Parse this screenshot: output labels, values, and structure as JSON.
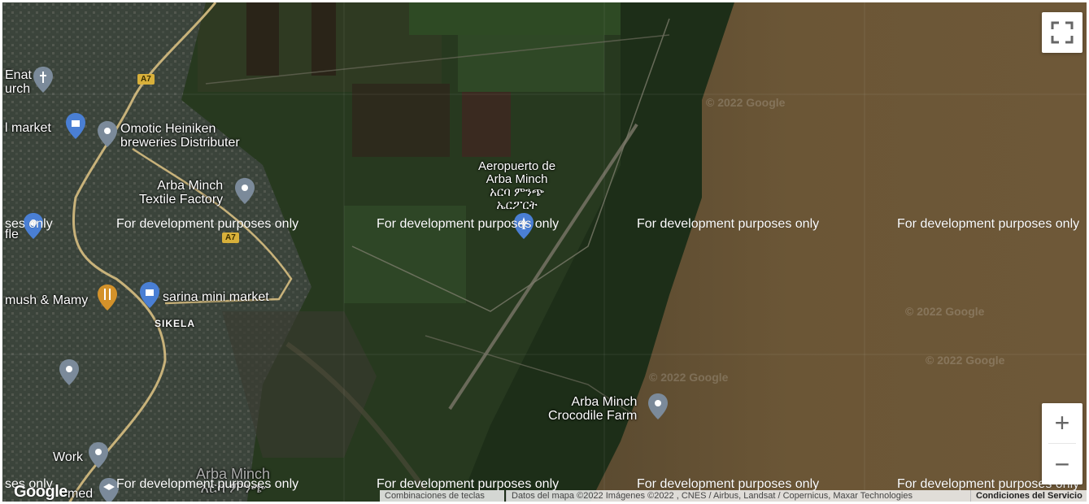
{
  "map": {
    "places": [
      {
        "id": "enat-church",
        "text": "Enat\nurch"
      },
      {
        "id": "market-left",
        "text": "l market"
      },
      {
        "id": "omotic",
        "text": "Omotic Heiniken\nbreweries Distributer"
      },
      {
        "id": "textile",
        "text": "Arba Minch\nTextile Factory"
      },
      {
        "id": "airport",
        "text": "Aeropuerto de\nArba Minch\nአርባ ምንጭ\nኤርፖርት"
      },
      {
        "id": "fle",
        "text": "fle"
      },
      {
        "id": "mush",
        "text": "mush & Mamy"
      },
      {
        "id": "sarina",
        "text": "sarina mini market"
      },
      {
        "id": "sikela",
        "text": "SIKELA"
      },
      {
        "id": "crocodile",
        "text": "Arba Minch\nCrocodile Farm"
      },
      {
        "id": "work",
        "text": "Work"
      },
      {
        "id": "arba-minch-town",
        "text": "Arba Minch\nአርባ ምንጭ"
      },
      {
        "id": "med",
        "text": "med"
      }
    ],
    "road_shields": [
      "A7",
      "A7"
    ],
    "dev_watermark": "For development purposes only",
    "dev_partial_left": "ses only",
    "dev_partial_right": "For development purposes only",
    "tile_watermark": "© 2022 Google",
    "attribution": {
      "shortcuts": "Combinaciones de teclas",
      "data": "Datos del mapa ©2022 Imágenes ©2022 , CNES / Airbus, Landsat / Copernicus, Maxar Technologies",
      "terms": "Condiciones del Servicio"
    },
    "logo": "Google",
    "controls": {
      "fullscreen_icon": "fullscreen-icon",
      "zoom_in": "+",
      "zoom_out": "−"
    }
  }
}
